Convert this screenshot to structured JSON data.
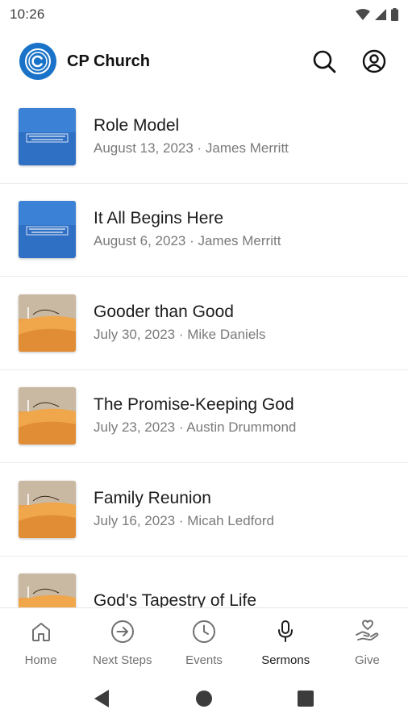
{
  "status": {
    "time": "10:26"
  },
  "header": {
    "title": "CP Church",
    "logo_letter": "C"
  },
  "sermons": [
    {
      "title": "Role Model",
      "meta": "August 13, 2023 · James Merritt",
      "art": "blue"
    },
    {
      "title": "It All Begins Here",
      "meta": "August 6, 2023 · James Merritt",
      "art": "blue"
    },
    {
      "title": "Gooder than Good",
      "meta": "July 30, 2023 · Mike Daniels",
      "art": "desert"
    },
    {
      "title": "The Promise-Keeping God",
      "meta": "July 23, 2023 · Austin Drummond",
      "art": "desert"
    },
    {
      "title": "Family Reunion",
      "meta": "July 16, 2023 · Micah Ledford",
      "art": "desert"
    },
    {
      "title": "God's Tapestry of Life",
      "meta": "",
      "art": "desert"
    }
  ],
  "nav": [
    {
      "label": "Home",
      "icon": "home-icon"
    },
    {
      "label": "Next Steps",
      "icon": "arrow-circle-icon"
    },
    {
      "label": "Events",
      "icon": "clock-icon"
    },
    {
      "label": "Sermons",
      "icon": "microphone-icon",
      "active": true
    },
    {
      "label": "Give",
      "icon": "heart-hand-icon"
    }
  ],
  "colors": {
    "accent": "#1a73c8",
    "text": "#1c1c1e",
    "muted": "#7a7a7a"
  }
}
